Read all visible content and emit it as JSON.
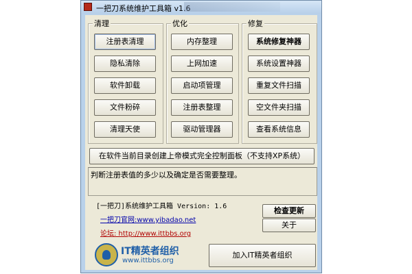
{
  "window": {
    "title": "一把刀系统维护工具箱 v1.6"
  },
  "groups": {
    "clean": {
      "label": "清理",
      "buttons": [
        "注册表清理",
        "隐私清除",
        "软件卸载",
        "文件粉碎",
        "清理天使"
      ]
    },
    "optimize": {
      "label": "优化",
      "buttons": [
        "内存整理",
        "上网加速",
        "启动项管理",
        "注册表整理",
        "驱动管理器"
      ]
    },
    "repair": {
      "label": "修复",
      "buttons": [
        "系统修复神器",
        "系统设置神器",
        "重复文件扫描",
        "空文件夹扫描",
        "查看系统信息"
      ]
    }
  },
  "control_panel_button": "在软件当前目录创建上帝模式完全控制面板（不支持XP系统）",
  "description_text": "判断注册表值的多少以及确定是否需要整理。",
  "info": {
    "version_text": "[一把刀]系统维护工具箱 Version: 1.6",
    "website_link": "一把刀官网:www.yibadao.net",
    "forum_link": "论坛: http://www.ittbbs.org"
  },
  "buttons": {
    "check_update": "检查更新",
    "about": "关于",
    "join": "加入IT精英者组织"
  },
  "logo": {
    "title": "IT精英者组织",
    "url": "www.ittbbs.org",
    "colors": {
      "primary": "#1f5fa8",
      "accent": "#c9b44a"
    }
  },
  "colors": {
    "window_frame": "#b9d1ea",
    "client_bg": "#ece9d8"
  }
}
